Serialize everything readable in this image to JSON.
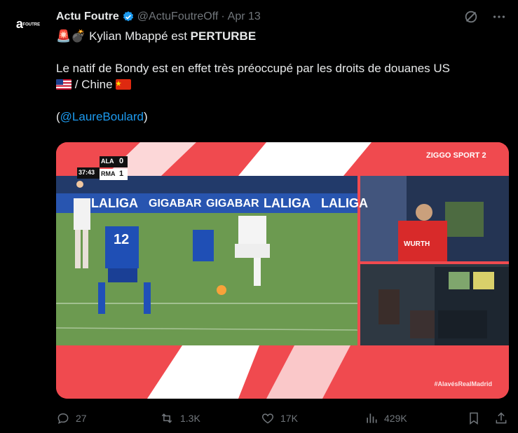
{
  "account": {
    "logo_text": "a",
    "logo_sub": "FOUTRE",
    "name": "Actu Foutre",
    "handle": "@ActuFoutreOff",
    "separator": "·",
    "date": "Apr 13"
  },
  "tweet": {
    "line1_emoji": "🚨💣",
    "line1_plain": " Kylian Mbappé est ",
    "line1_bold": "PERTURBE",
    "line2": "Le natif de Bondy est en effet très préoccupé par les droits de douanes US",
    "line3_mid": " / Chine ",
    "mention_open": "(",
    "mention": "@LaureBoulard",
    "mention_close": ")"
  },
  "media": {
    "team_home": "ALA",
    "team_away": "RMA",
    "score_home": "0",
    "score_away": "1",
    "clock": "37:43",
    "broadcaster": "ZIGGO SPORT",
    "channel_num": "2",
    "ad_laliga": "LALIGA",
    "ad_gigabar": "GIGABAR",
    "var_badge": "WURTH",
    "player_number": "12",
    "hashtag": "#AlavésRealMadrid"
  },
  "actions": {
    "replies": "27",
    "reposts": "1.3K",
    "likes": "17K",
    "views": "429K"
  },
  "colors": {
    "accent": "#1d9bf0",
    "muted": "#71767b",
    "media_red": "#f04a4f"
  }
}
